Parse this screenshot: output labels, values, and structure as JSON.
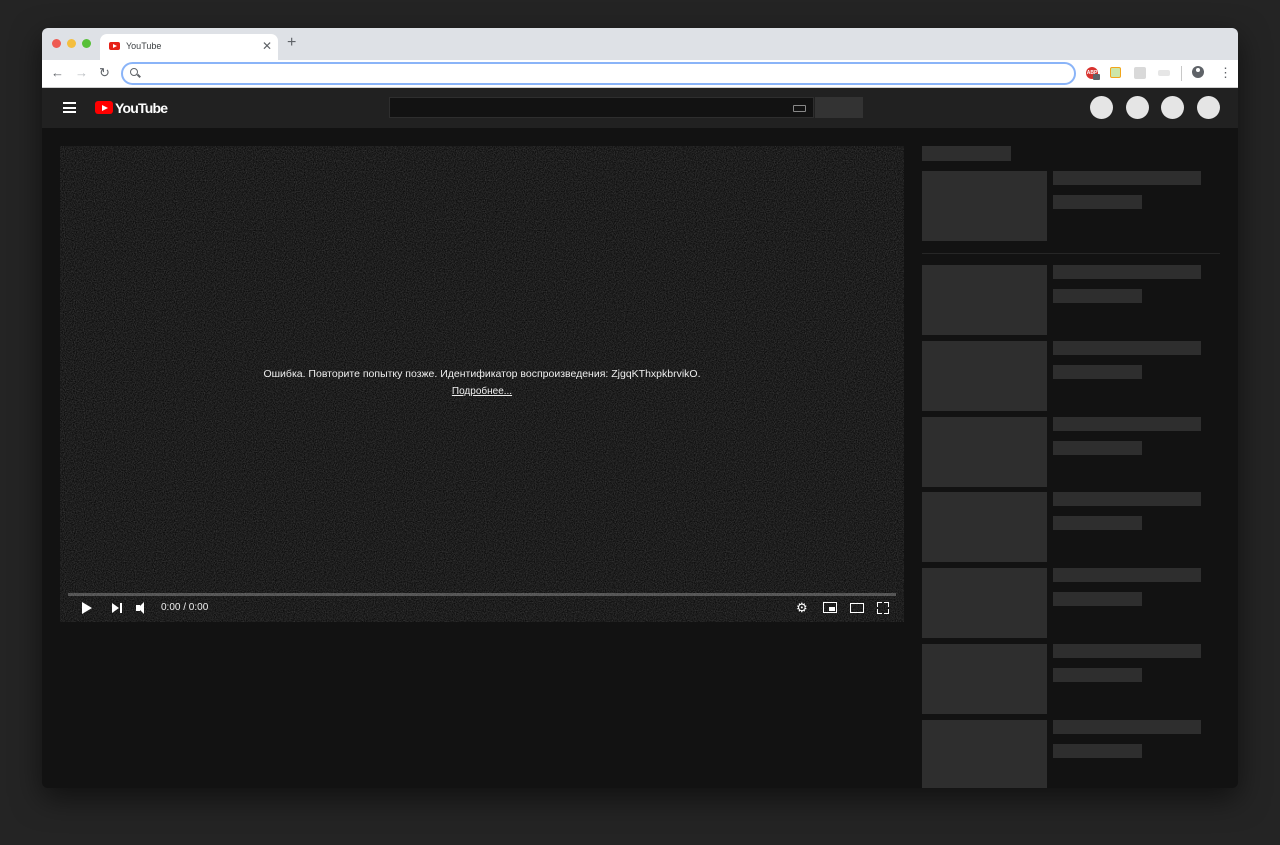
{
  "browser": {
    "tab_title": "YouTube",
    "tab_close": "✕",
    "new_tab": "+",
    "nav_back": "←",
    "nav_forward": "→",
    "nav_reload": "↻",
    "address_value": "",
    "menu_glyph": "⋮",
    "extensions": [
      "adblock-icon",
      "extension-icon",
      "extension-icon",
      "extension-icon"
    ],
    "ext_abp_label": "ABP"
  },
  "youtube": {
    "logo_text": "YouTube",
    "search_value": "",
    "player": {
      "error_message": "Ошибка. Повторите попытку позже. Идентификатор воспроизведения: ZjgqKThxpkbrvikO.",
      "error_link": "Подробнее...",
      "time": "0:00 / 0:00",
      "gear_glyph": "⚙"
    }
  },
  "colors": {
    "accent": "#ff0000",
    "background": "#121212",
    "masthead": "#212121",
    "skeleton": "#2e2e2e"
  }
}
